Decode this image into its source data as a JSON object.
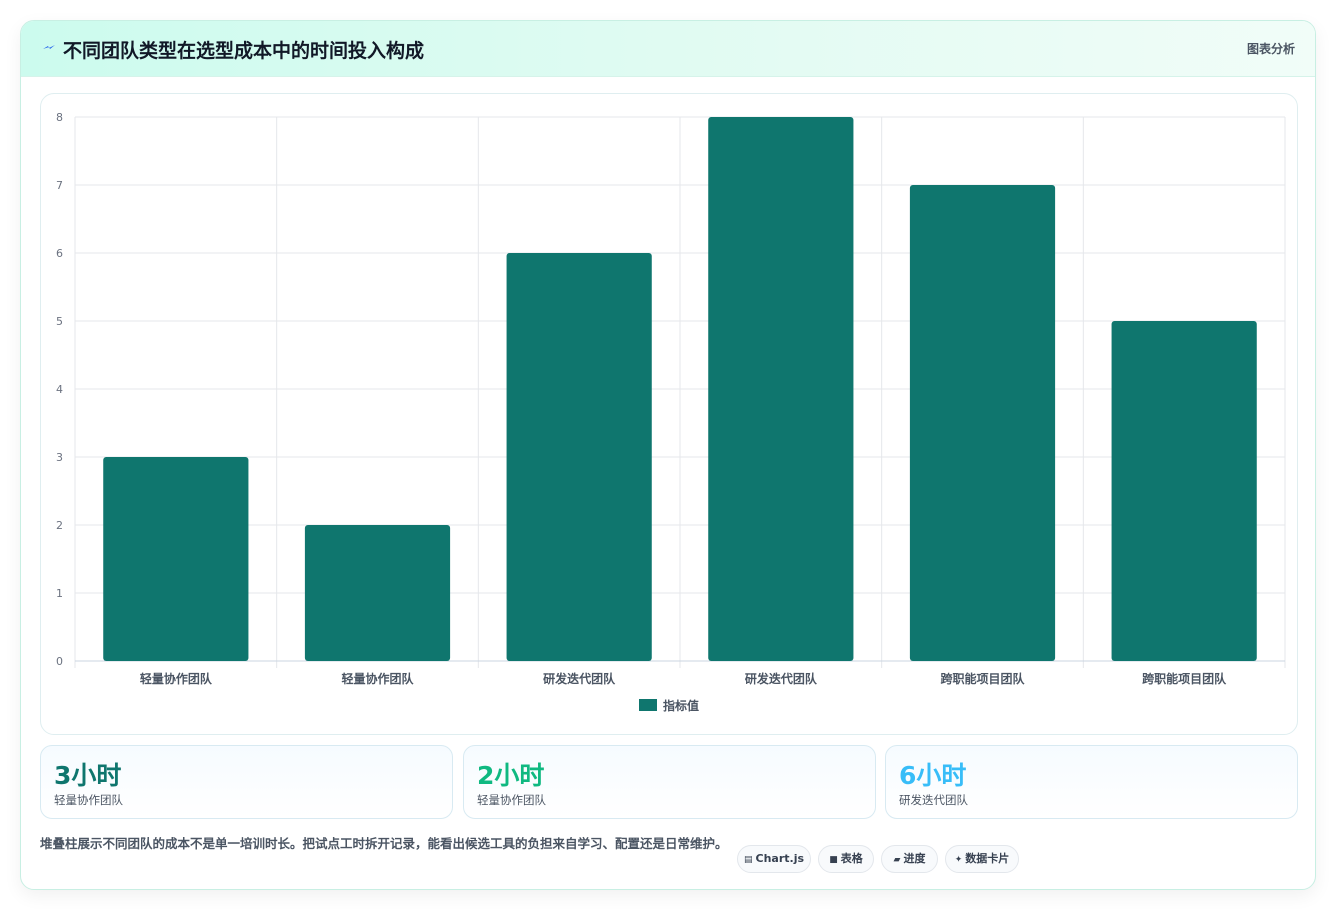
{
  "header": {
    "title": "不同团队类型在选型成本中的时间投入构成",
    "action_label": "图表分析",
    "icon": "lightning-icon",
    "accent": "#2563eb"
  },
  "chart_data": {
    "type": "bar",
    "categories": [
      "轻量协作团队",
      "轻量协作团队",
      "研发迭代团队",
      "研发迭代团队",
      "跨职能项目团队",
      "跨职能项目团队"
    ],
    "series": [
      {
        "name": "指标值",
        "values": [
          3,
          2,
          6,
          8,
          7,
          5
        ],
        "color": "#0f766e"
      }
    ],
    "ylim": [
      0,
      8
    ],
    "yticks": [
      0,
      1,
      2,
      3,
      4,
      5,
      6,
      7,
      8
    ],
    "grid": true,
    "legend": "bottom"
  },
  "stats": [
    {
      "value": "3小时",
      "label": "轻量协作团队",
      "color": "#0f766e"
    },
    {
      "value": "2小时",
      "label": "轻量协作团队",
      "color": "#10b981"
    },
    {
      "value": "6小时",
      "label": "研发迭代团队",
      "color": "#38bdf8"
    }
  ],
  "footer": {
    "description": "堆叠柱展示不同团队的成本不是单一培训时长。把试点工时拆开记录，能看出候选工具的负担来自学习、配置还是日常维护。",
    "tags": [
      {
        "label": "Chart.js",
        "icon": "chart-icon"
      },
      {
        "label": "表格",
        "icon": "table-icon"
      },
      {
        "label": "进度",
        "icon": "progress-icon"
      },
      {
        "label": "数据卡片",
        "icon": "sparkle-icon"
      }
    ]
  }
}
